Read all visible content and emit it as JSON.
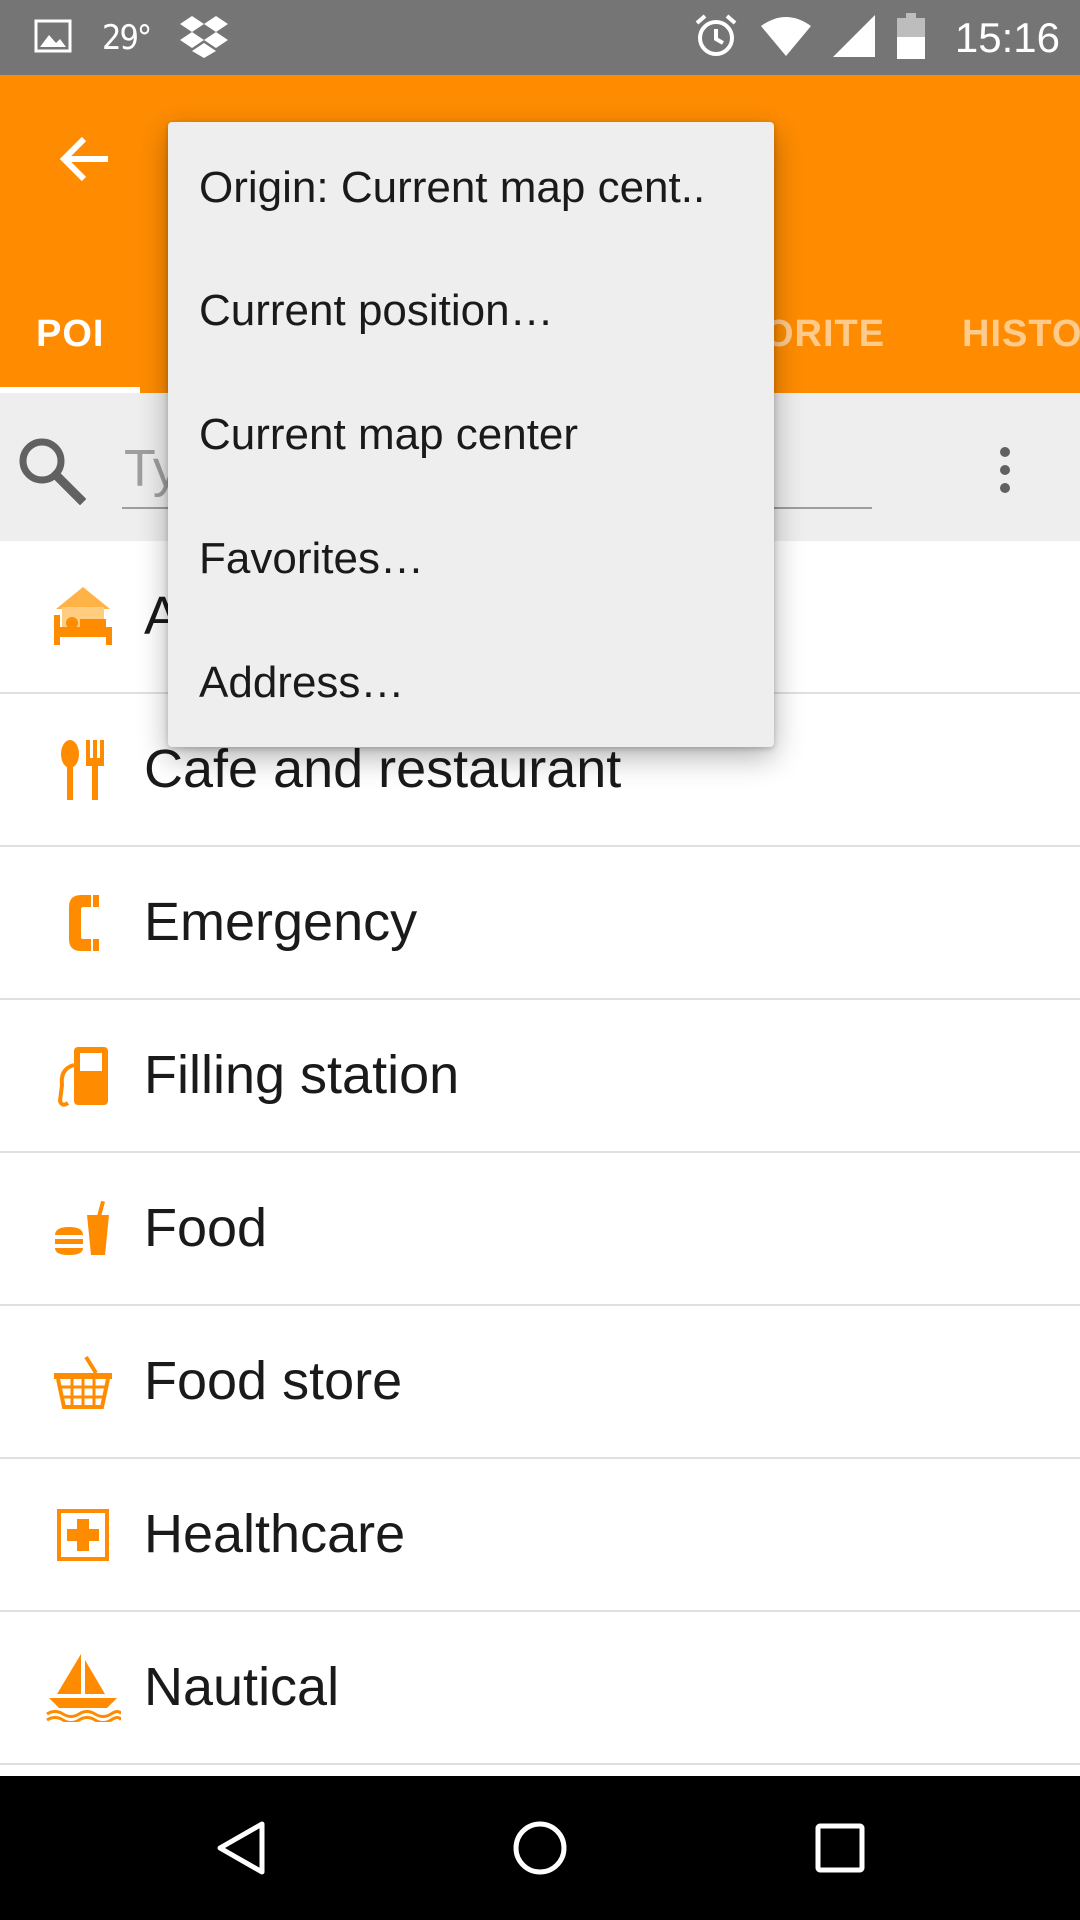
{
  "status_bar": {
    "temperature": "29°",
    "time": "15:16",
    "icons": [
      "image-icon",
      "dropbox-icon",
      "alarm-icon",
      "wifi-icon",
      "signal-icon",
      "battery-icon"
    ]
  },
  "app_bar": {
    "back_icon": "arrow-left-icon",
    "tabs": [
      {
        "label": "POI",
        "active": true
      },
      {
        "label": "ORITE",
        "active": false
      },
      {
        "label": "HISTO",
        "active": false
      }
    ]
  },
  "search": {
    "placeholder": "Ty",
    "value": ""
  },
  "categories": [
    {
      "label": "A",
      "icon": "accommodation-icon"
    },
    {
      "label": "Cafe and restaurant",
      "icon": "fork-knife-icon"
    },
    {
      "label": "Emergency",
      "icon": "phone-icon"
    },
    {
      "label": "Filling station",
      "icon": "fuel-pump-icon"
    },
    {
      "label": "Food",
      "icon": "fast-food-icon"
    },
    {
      "label": "Food store",
      "icon": "basket-icon"
    },
    {
      "label": "Healthcare",
      "icon": "medical-cross-icon"
    },
    {
      "label": "Nautical",
      "icon": "sailboat-icon"
    }
  ],
  "dropdown": {
    "items": [
      "Origin: Current map cent..",
      "Current position…",
      "Current map center",
      "Favorites…",
      "Address…"
    ]
  },
  "nav_bar": {
    "icons": [
      "back-triangle-icon",
      "home-circle-icon",
      "recents-square-icon"
    ]
  },
  "colors": {
    "accent": "#FF8C00",
    "status_bar": "#757575",
    "search_bg": "#EEEEEE",
    "menu_bg": "#EEEEEE",
    "nav_bar": "#000000"
  }
}
